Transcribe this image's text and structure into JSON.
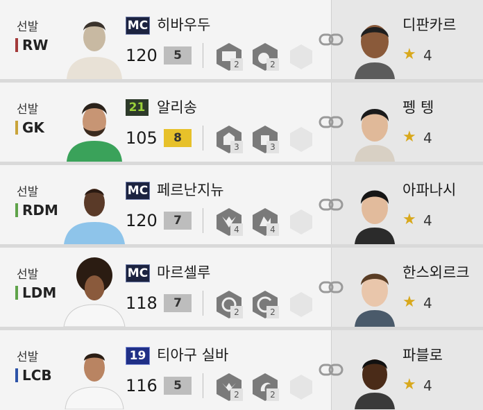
{
  "rows": [
    {
      "slot": "선발",
      "pos": "RW",
      "pos_color": "#a33a3a",
      "season": "MC",
      "season_bg": "#1c2340",
      "season_fg": "#ffffff",
      "name": "히바우두",
      "ovr": "120",
      "grade": "5",
      "grade_bg": "#bdbdbd",
      "traits": [
        "2",
        "2"
      ],
      "coach": "디판카르",
      "coach_grade": "4"
    },
    {
      "slot": "선발",
      "pos": "GK",
      "pos_color": "#c9a43a",
      "season": "21",
      "season_bg": "#2d3a2a",
      "season_fg": "#9bd13a",
      "name": "알리송",
      "ovr": "105",
      "grade": "8",
      "grade_bg": "#e7c12a",
      "traits": [
        "3",
        "3"
      ],
      "coach": "펭 텡",
      "coach_grade": "4"
    },
    {
      "slot": "선발",
      "pos": "RDM",
      "pos_color": "#5fa34a",
      "season": "MC",
      "season_bg": "#1c2340",
      "season_fg": "#ffffff",
      "name": "페르난지뉴",
      "ovr": "120",
      "grade": "7",
      "grade_bg": "#bdbdbd",
      "traits": [
        "4",
        "4"
      ],
      "coach": "아파나시",
      "coach_grade": "4"
    },
    {
      "slot": "선발",
      "pos": "LDM",
      "pos_color": "#5fa34a",
      "season": "MC",
      "season_bg": "#1c2340",
      "season_fg": "#ffffff",
      "name": "마르셀루",
      "ovr": "118",
      "grade": "7",
      "grade_bg": "#bdbdbd",
      "traits": [
        "2",
        "2"
      ],
      "coach": "한스외르크",
      "coach_grade": "4"
    },
    {
      "slot": "선발",
      "pos": "LCB",
      "pos_color": "#2d53a8",
      "season": "19",
      "season_bg": "#1f2f86",
      "season_fg": "#ffffff",
      "name": "티아구 실바",
      "ovr": "116",
      "grade": "5",
      "grade_bg": "#bdbdbd",
      "traits": [
        "2",
        "2"
      ],
      "coach": "파블로",
      "coach_grade": "4"
    }
  ]
}
